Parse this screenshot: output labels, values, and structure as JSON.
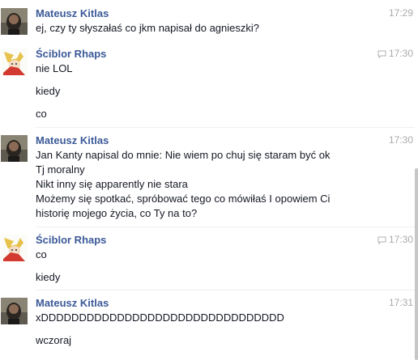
{
  "thread": {
    "groups": [
      {
        "author": "Mateusz Kitlas",
        "time": "17:29",
        "avatar": "avatar-mateusz",
        "seen_icon": false,
        "messages": [
          "ej, czy ty słyszałaś co jkm napisał do agnieszki?"
        ]
      },
      {
        "author": "Ściblor Rhaps",
        "time": "17:30",
        "avatar": "avatar-sciblor",
        "seen_icon": true,
        "messages": [
          "nie LOL",
          "kiedy",
          "co"
        ]
      },
      {
        "author": "Mateusz Kitlas",
        "time": "17:30",
        "avatar": "avatar-mateusz",
        "seen_icon": false,
        "messages": [
          "Jan Kanty napisal do mnie: Nie wiem po chuj się staram być ok",
          "Tj moralny",
          "Nikt inny się apparently nie stara",
          "Możemy się spotkać, spróbować tego co mówiłaś I opowiem Ci",
          "historię mojego życia, co Ty na to?"
        ]
      },
      {
        "author": "Ściblor Rhaps",
        "time": "17:30",
        "avatar": "avatar-sciblor",
        "seen_icon": true,
        "messages": [
          "co",
          "kiedy"
        ]
      },
      {
        "author": "Mateusz Kitlas",
        "time": "17:31",
        "avatar": "avatar-mateusz",
        "seen_icon": false,
        "messages": [
          "xDDDDDDDDDDDDDDDDDDDDDDDDDDDDDDDD",
          "wczoraj"
        ]
      }
    ]
  },
  "colors": {
    "author_name": "#3b5998",
    "timestamp": "#aaaaaa",
    "message_text": "#141823"
  }
}
